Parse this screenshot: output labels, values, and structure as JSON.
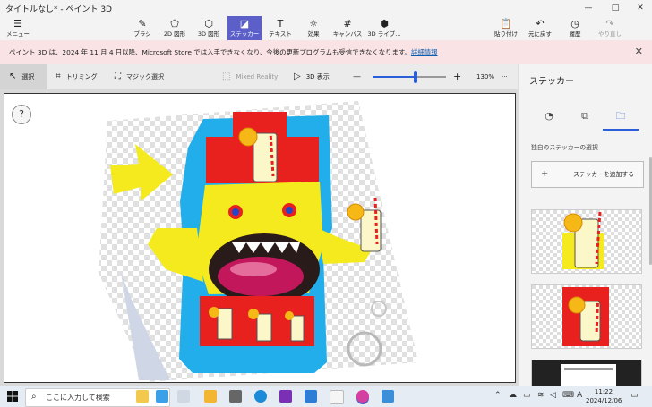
{
  "window": {
    "title": "タイトルなし* - ペイント 3D",
    "controls": [
      "—",
      "□",
      "✕"
    ]
  },
  "ribbon": {
    "menu": "メニュー",
    "tools": [
      "ブラシ",
      "2D 図形",
      "3D 図形",
      "ステッカー",
      "テキスト",
      "効果",
      "キャンバス",
      "3D ライブ..."
    ],
    "active_tool": "ステッカー",
    "actions": [
      "貼り付け",
      "元に戻す",
      "履歴",
      "やり直し"
    ]
  },
  "notice": {
    "message": "ペイント 3D は、2024 年 11 月 4 日以降、Microsoft Store では入手できなくなり、今後の更新プログラムも受信できなくなります。",
    "link": "詳細情報"
  },
  "toolbar": {
    "select": "選択",
    "crop": "トリミング",
    "magic_select": "マジック選択",
    "mixed_reality": "Mixed Reality",
    "view_3d": "3D 表示",
    "zoom_minus": "—",
    "zoom_plus": "+",
    "zoom": "130%",
    "more": "···",
    "zoom_level": 0.58
  },
  "panel": {
    "title": "ステッカー",
    "subtitle": "独自のステッカーの選択",
    "add_sticker": "ステッカーを追加する"
  },
  "taskbar": {
    "search_placeholder": "ここに入力して検索",
    "input_indicator": "A",
    "time": "11:22",
    "date": "2024/12/06"
  },
  "help": "?",
  "colors": {
    "accent": "#5b5fc7",
    "notice_bg": "#f9e3e4",
    "link": "#0b5cad",
    "sticker_red": "#e8201e",
    "sticker_blue": "#22aeea",
    "sticker_yellow": "#f5ea1d"
  }
}
